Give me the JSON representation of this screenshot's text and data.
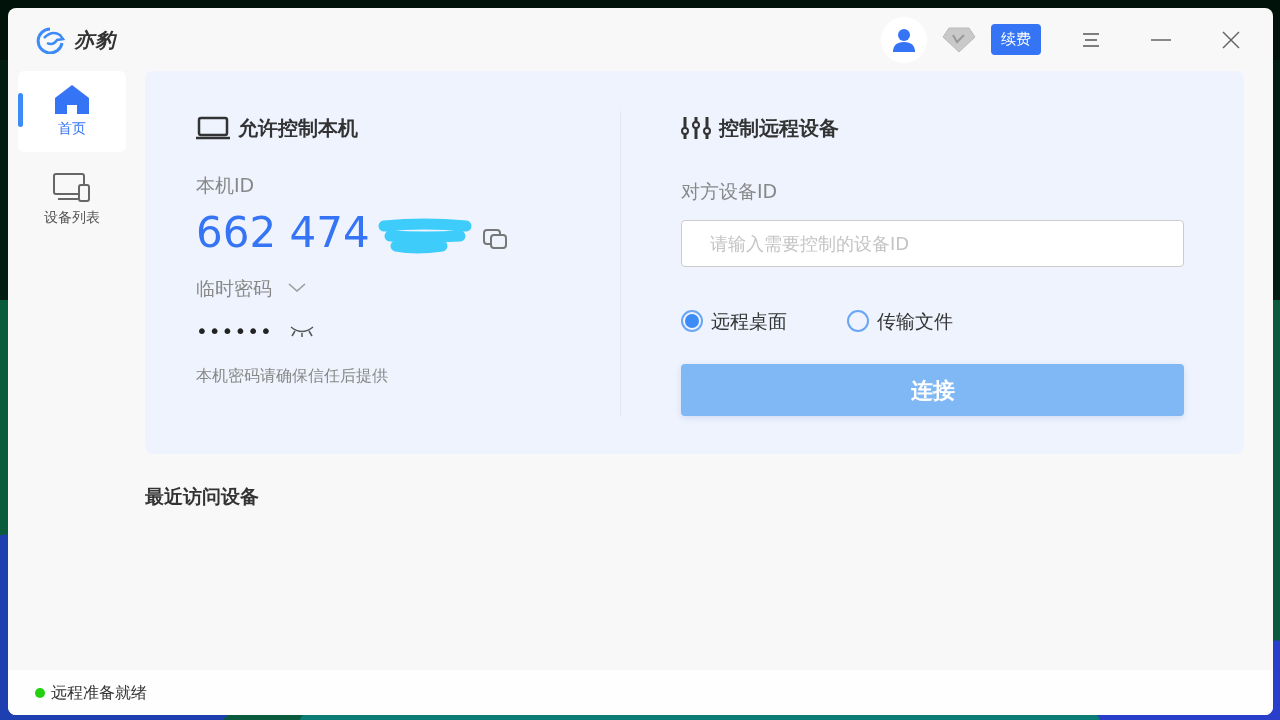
{
  "app": {
    "name": "亦豹"
  },
  "titlebar": {
    "renew_button": "续费"
  },
  "sidebar": {
    "items": [
      {
        "label": "首页",
        "selected": true
      },
      {
        "label": "设备列表",
        "selected": false
      }
    ]
  },
  "local": {
    "title": "允许控制本机",
    "id_label": "本机ID",
    "id": "662 474",
    "password_label": "临时密码",
    "password": "••••••",
    "note": "本机密码请确保信任后提供"
  },
  "remote": {
    "title": "控制远程设备",
    "id_label": "对方设备ID",
    "id_field": {
      "placeholder": "请输入需要控制的设备ID"
    },
    "modes": [
      {
        "label": "远程桌面",
        "selected": true
      },
      {
        "label": "传输文件",
        "selected": false
      }
    ],
    "connect_button": {
      "label": "连接",
      "disabled": true
    }
  },
  "recent": {
    "title": "最近访问设备"
  },
  "status_bar": {
    "text": "远程准备就绪",
    "online": true
  }
}
